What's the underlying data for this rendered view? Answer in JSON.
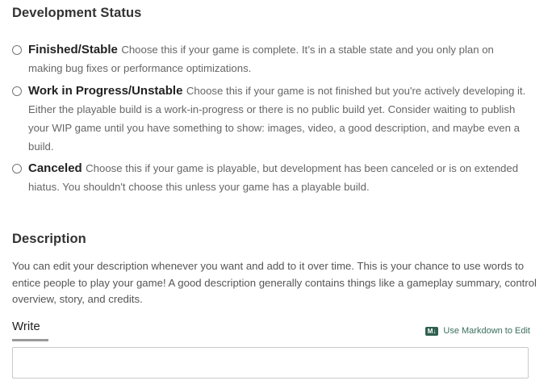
{
  "development_status": {
    "title": "Development Status",
    "options": [
      {
        "label": "Finished/Stable",
        "description": "Choose this if your game is complete. It’s in a stable state and you only plan on making bug fixes or performance optimizations."
      },
      {
        "label": "Work in Progress/Unstable",
        "description": "Choose this if your game is not finished but you're actively developing it. Either the playable build is a work-in-progress or there is no public build yet. Consider waiting to publish your WIP game until you have something to show: images, video, a good description, and maybe even a build."
      },
      {
        "label": "Canceled",
        "description": "Choose this if your game is playable, but development has been canceled or is on extended hiatus. You shouldn't choose this unless your game has a playable build."
      }
    ]
  },
  "description_section": {
    "title": "Description",
    "help_text": "You can edit your description whenever you want and add to it over time. This is your chance to use words to entice people to play your game! A good description generally contains things like a gameplay summary, control overview, story, and credits.",
    "tab_write": "Write",
    "markdown_badge": "M↓",
    "markdown_link": "Use Markdown to Edit",
    "editor_value": ""
  }
}
